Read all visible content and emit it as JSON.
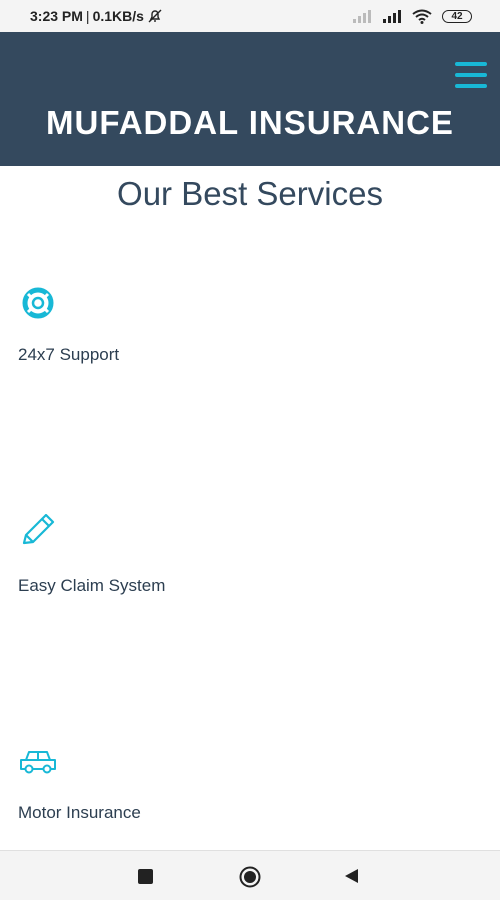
{
  "status_bar": {
    "time": "3:23 PM",
    "separator": "|",
    "speed": "0.1KB/s",
    "battery": "42",
    "icons": [
      "alarm-off-icon",
      "signal-weak-icon",
      "signal-icon",
      "wifi-icon",
      "battery-icon"
    ]
  },
  "header": {
    "brand": "MUFADDAL INSURANCE",
    "menu_icon": "hamburger-menu-icon",
    "background": "#34495e",
    "accent": "#18b8d6"
  },
  "main": {
    "title": "Our Best Services",
    "services": [
      {
        "label": "24x7 Support",
        "icon": "life-ring-icon"
      },
      {
        "label": "Easy Claim System",
        "icon": "pencil-icon"
      },
      {
        "label": "Motor Insurance",
        "icon": "car-icon"
      }
    ]
  },
  "nav_bar": {
    "buttons": [
      "recent-apps-icon",
      "home-icon",
      "back-icon"
    ]
  }
}
